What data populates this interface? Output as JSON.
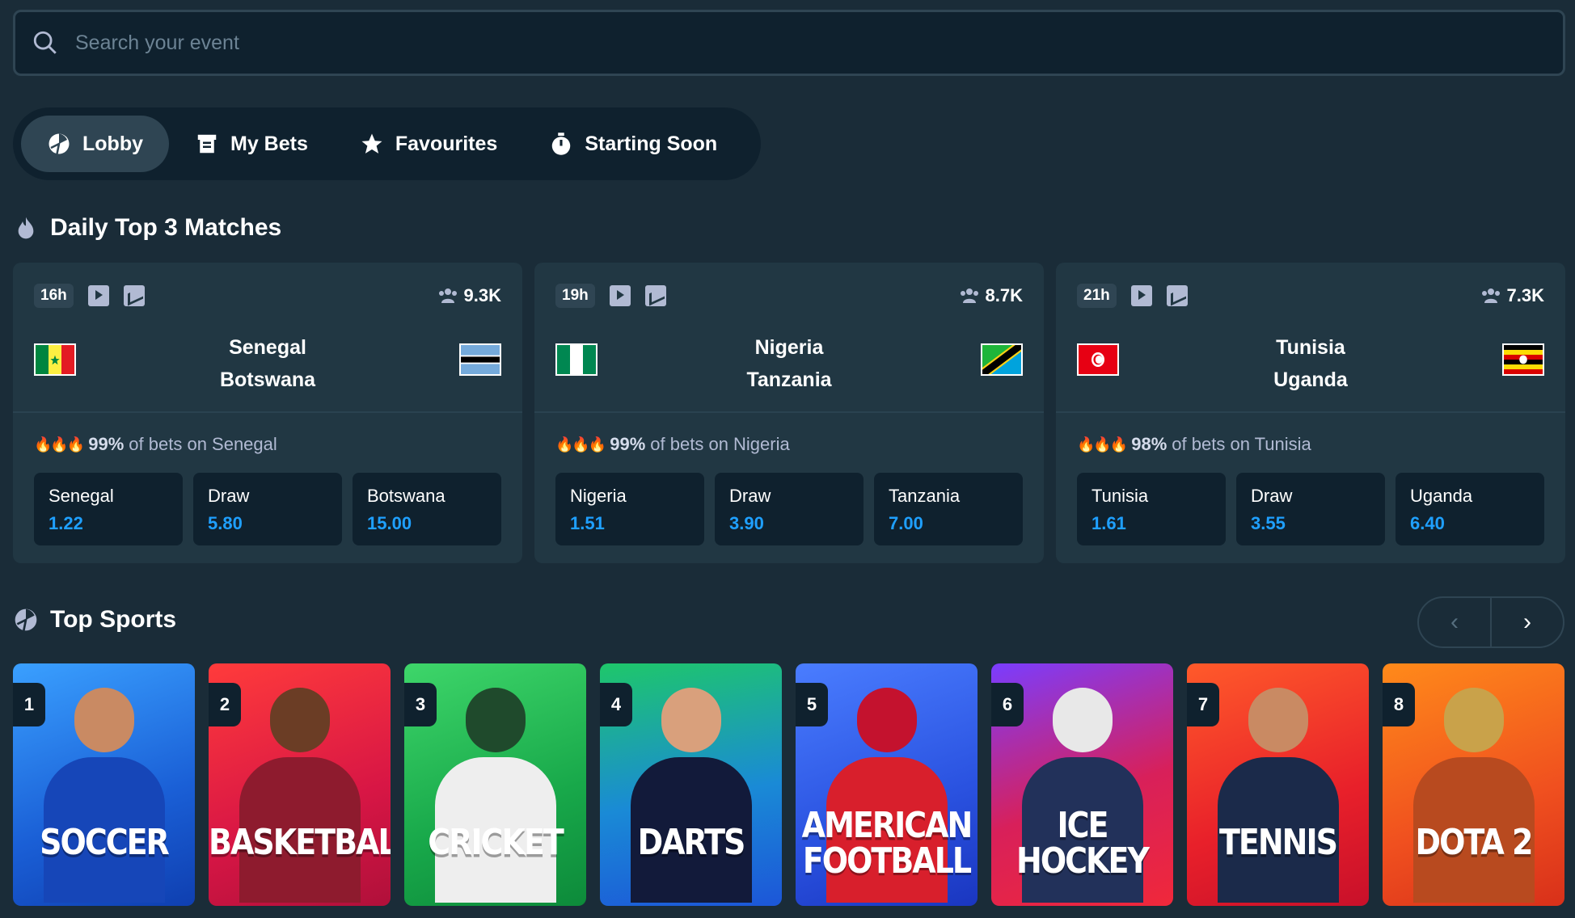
{
  "search": {
    "placeholder": "Search your event"
  },
  "tabs": [
    {
      "label": "Lobby",
      "icon": "ball-icon",
      "active": true
    },
    {
      "label": "My Bets",
      "icon": "receipt-icon"
    },
    {
      "label": "Favourites",
      "icon": "star-icon"
    },
    {
      "label": "Starting Soon",
      "icon": "stopwatch-icon"
    }
  ],
  "daily": {
    "title": "Daily Top 3 Matches",
    "matches": [
      {
        "time": "16h",
        "viewers": "9.3K",
        "home": "Senegal",
        "away": "Botswana",
        "pct_value": "99%",
        "pct_text": "of bets on Senegal",
        "odds": [
          {
            "name": "Senegal",
            "value": "1.22"
          },
          {
            "name": "Draw",
            "value": "5.80"
          },
          {
            "name": "Botswana",
            "value": "15.00"
          }
        ]
      },
      {
        "time": "19h",
        "viewers": "8.7K",
        "home": "Nigeria",
        "away": "Tanzania",
        "pct_value": "99%",
        "pct_text": "of bets on Nigeria",
        "odds": [
          {
            "name": "Nigeria",
            "value": "1.51"
          },
          {
            "name": "Draw",
            "value": "3.90"
          },
          {
            "name": "Tanzania",
            "value": "7.00"
          }
        ]
      },
      {
        "time": "21h",
        "viewers": "7.3K",
        "home": "Tunisia",
        "away": "Uganda",
        "pct_value": "98%",
        "pct_text": "of bets on Tunisia",
        "odds": [
          {
            "name": "Tunisia",
            "value": "1.61"
          },
          {
            "name": "Draw",
            "value": "3.55"
          },
          {
            "name": "Uganda",
            "value": "6.40"
          }
        ]
      }
    ]
  },
  "top_sports": {
    "title": "Top Sports",
    "items": [
      {
        "rank": "1",
        "name": "SOCCER"
      },
      {
        "rank": "2",
        "name": "BASKETBALL"
      },
      {
        "rank": "3",
        "name": "CRICKET"
      },
      {
        "rank": "4",
        "name": "DARTS"
      },
      {
        "rank": "5",
        "name": "AMERICAN FOOTBALL"
      },
      {
        "rank": "6",
        "name": "ICE HOCKEY"
      },
      {
        "rank": "7",
        "name": "TENNIS"
      },
      {
        "rank": "8",
        "name": "DOTA 2"
      }
    ]
  },
  "colors": {
    "background": "#1a2c38",
    "panel": "#213743",
    "odds_value": "#1fa0ff"
  }
}
